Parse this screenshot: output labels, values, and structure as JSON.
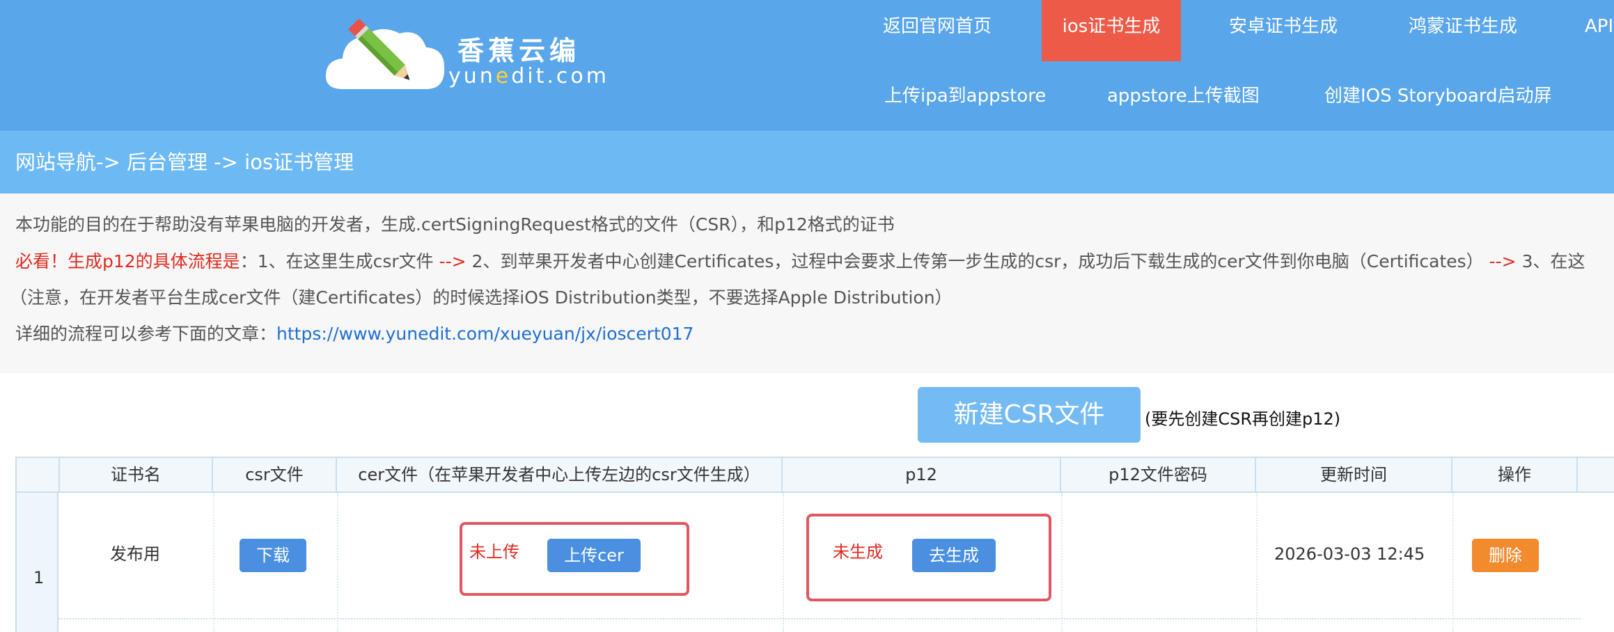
{
  "header": {
    "logo": {
      "title": "香蕉云编",
      "sub_pre": "yun",
      "sub_accent": "e",
      "sub_post": "dit.com"
    },
    "nav_row1": [
      {
        "label": "返回官网首页",
        "active": false
      },
      {
        "label": "ios证书生成",
        "active": true
      },
      {
        "label": "安卓证书生成",
        "active": false
      },
      {
        "label": "鸿蒙证书生成",
        "active": false
      },
      {
        "label": "API",
        "active": false
      }
    ],
    "nav_row2": [
      {
        "label": "上传ipa到appstore"
      },
      {
        "label": "appstore上传截图"
      },
      {
        "label": "创建IOS Storyboard启动屏"
      }
    ]
  },
  "breadcrumb": {
    "text": "网站导航-> 后台管理 -> ios证书管理"
  },
  "info": {
    "line1": "本功能的目的在于帮助没有苹果电脑的开发者，生成.certSigningRequest格式的文件（CSR），和p12格式的证书",
    "line2": {
      "must_read": "必看！生成p12的具体流程是",
      "colon": "：",
      "step1": "1、在这里生成csr文件 ",
      "arrow1": "-->",
      "step2": " 2、到苹果开发者中心创建Certificates，过程中会要求上传第一步生成的csr，成功后下载生成的cer文件到你电脑（Certificates） ",
      "arrow2": "-->",
      "step3": " 3、在这"
    },
    "line3": "（注意，在开发者平台生成cer文件（建Certificates）的时候选择iOS Distribution类型，不要选择Apple Distribution）",
    "line4": {
      "label": "详细的流程可以参考下面的文章：",
      "url": "https://www.yunedit.com/xueyuan/jx/ioscert017"
    }
  },
  "csr": {
    "button_label": "新建CSR文件",
    "note": "(要先创建CSR再创建p12)"
  },
  "table": {
    "headers": [
      "证书名",
      "csr文件",
      "cer文件（在苹果开发者中心上传左边的csr文件生成）",
      "p12",
      "p12文件密码",
      "更新时间",
      "操作"
    ],
    "rows": [
      {
        "index": "1",
        "name": "发布用",
        "csr_button": "下载",
        "cer_status": "未上传",
        "cer_button": "上传cer",
        "p12_status": "未生成",
        "p12_button": "去生成",
        "p12_password": "",
        "updated": "2026-03-03 12:45",
        "action_button": "删除"
      }
    ]
  },
  "colors": {
    "header_bg": "#5aa6ea",
    "nav_active": "#ee5a48",
    "breadcrumb_bg": "#6db9f4",
    "primary_button": "#4a8fe0",
    "danger_button": "#f28a2e",
    "highlight_box": "#e05760",
    "status_red": "#e02a1f"
  }
}
